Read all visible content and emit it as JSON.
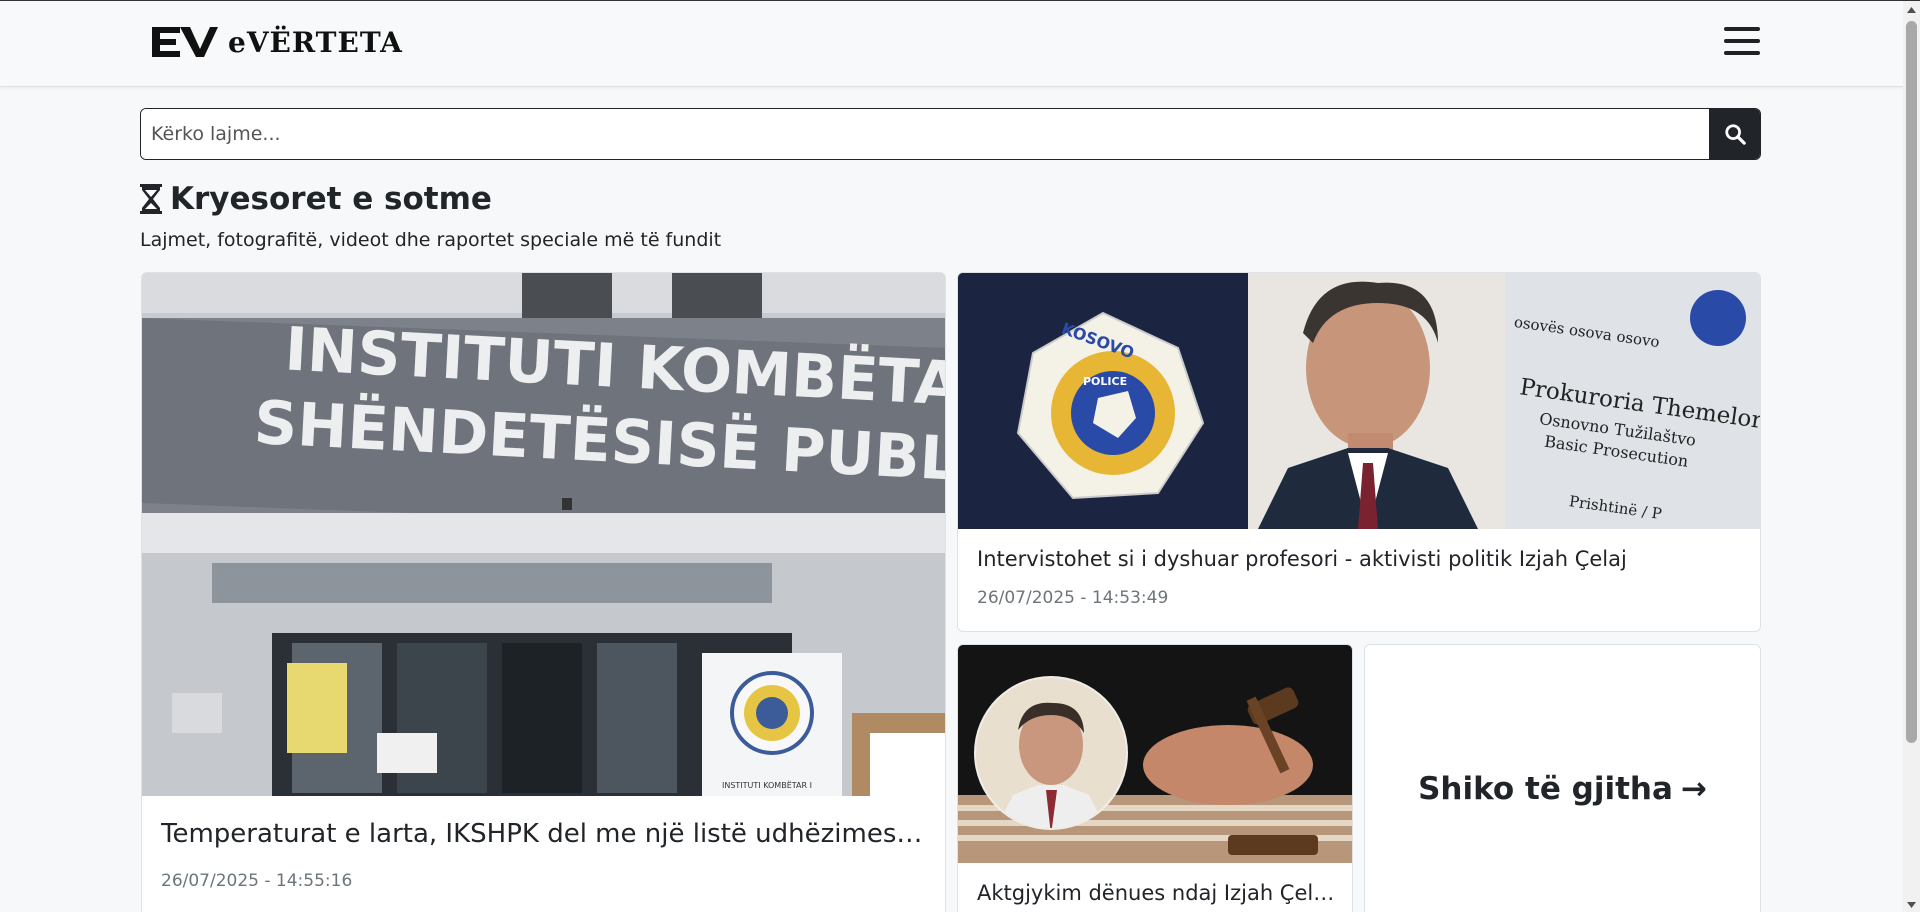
{
  "header": {
    "logo_text": "eVËRTETA",
    "menu_icon": "hamburger-menu-icon"
  },
  "search": {
    "placeholder": "Kërko lajme...",
    "icon": "search-icon"
  },
  "section": {
    "icon": "hourglass-icon",
    "title": "Kryesoret e sotme",
    "subtitle": "Lajmet, fotografitë, videot dhe raportet speciale më të fundit"
  },
  "articles": [
    {
      "title": "Temperaturat e larta, IKSHPK del me një listë udhëzimesh për qytetarët",
      "date": "26/07/2025 - 14:55:16",
      "image_text_line1": "INSTITUTI KOMBËTAR I",
      "image_text_line2": "SHËNDETËSISË PUBLIKE",
      "image_small_text": "INSTITUTI KOMBËTAR I"
    },
    {
      "title": "Intervistohet si i dyshuar profesori - aktivisti politik Izjah Çelaj",
      "date": "26/07/2025 - 14:53:49",
      "image_badge_text": "KOSOVO",
      "image_badge_sub": "POLICE",
      "image_sign_top": "osovës\nosova\nosovo",
      "image_sign_main": "Prokuroria Themelore",
      "image_sign_sub1": "Osnovno Tužilaštvo",
      "image_sign_sub2": "Basic Prosecution",
      "image_sign_city": "Prishtinë / P"
    },
    {
      "title": "Aktgjykim dënues ndaj Izjah Çelaj -t",
      "date": ""
    }
  ],
  "see_all": {
    "label": "Shiko të gjitha",
    "arrow": "→"
  },
  "colors": {
    "dark": "#212529",
    "muted": "#6c757d",
    "header_bg": "#f8f9fa",
    "page_bg": "#f7f8f9"
  }
}
